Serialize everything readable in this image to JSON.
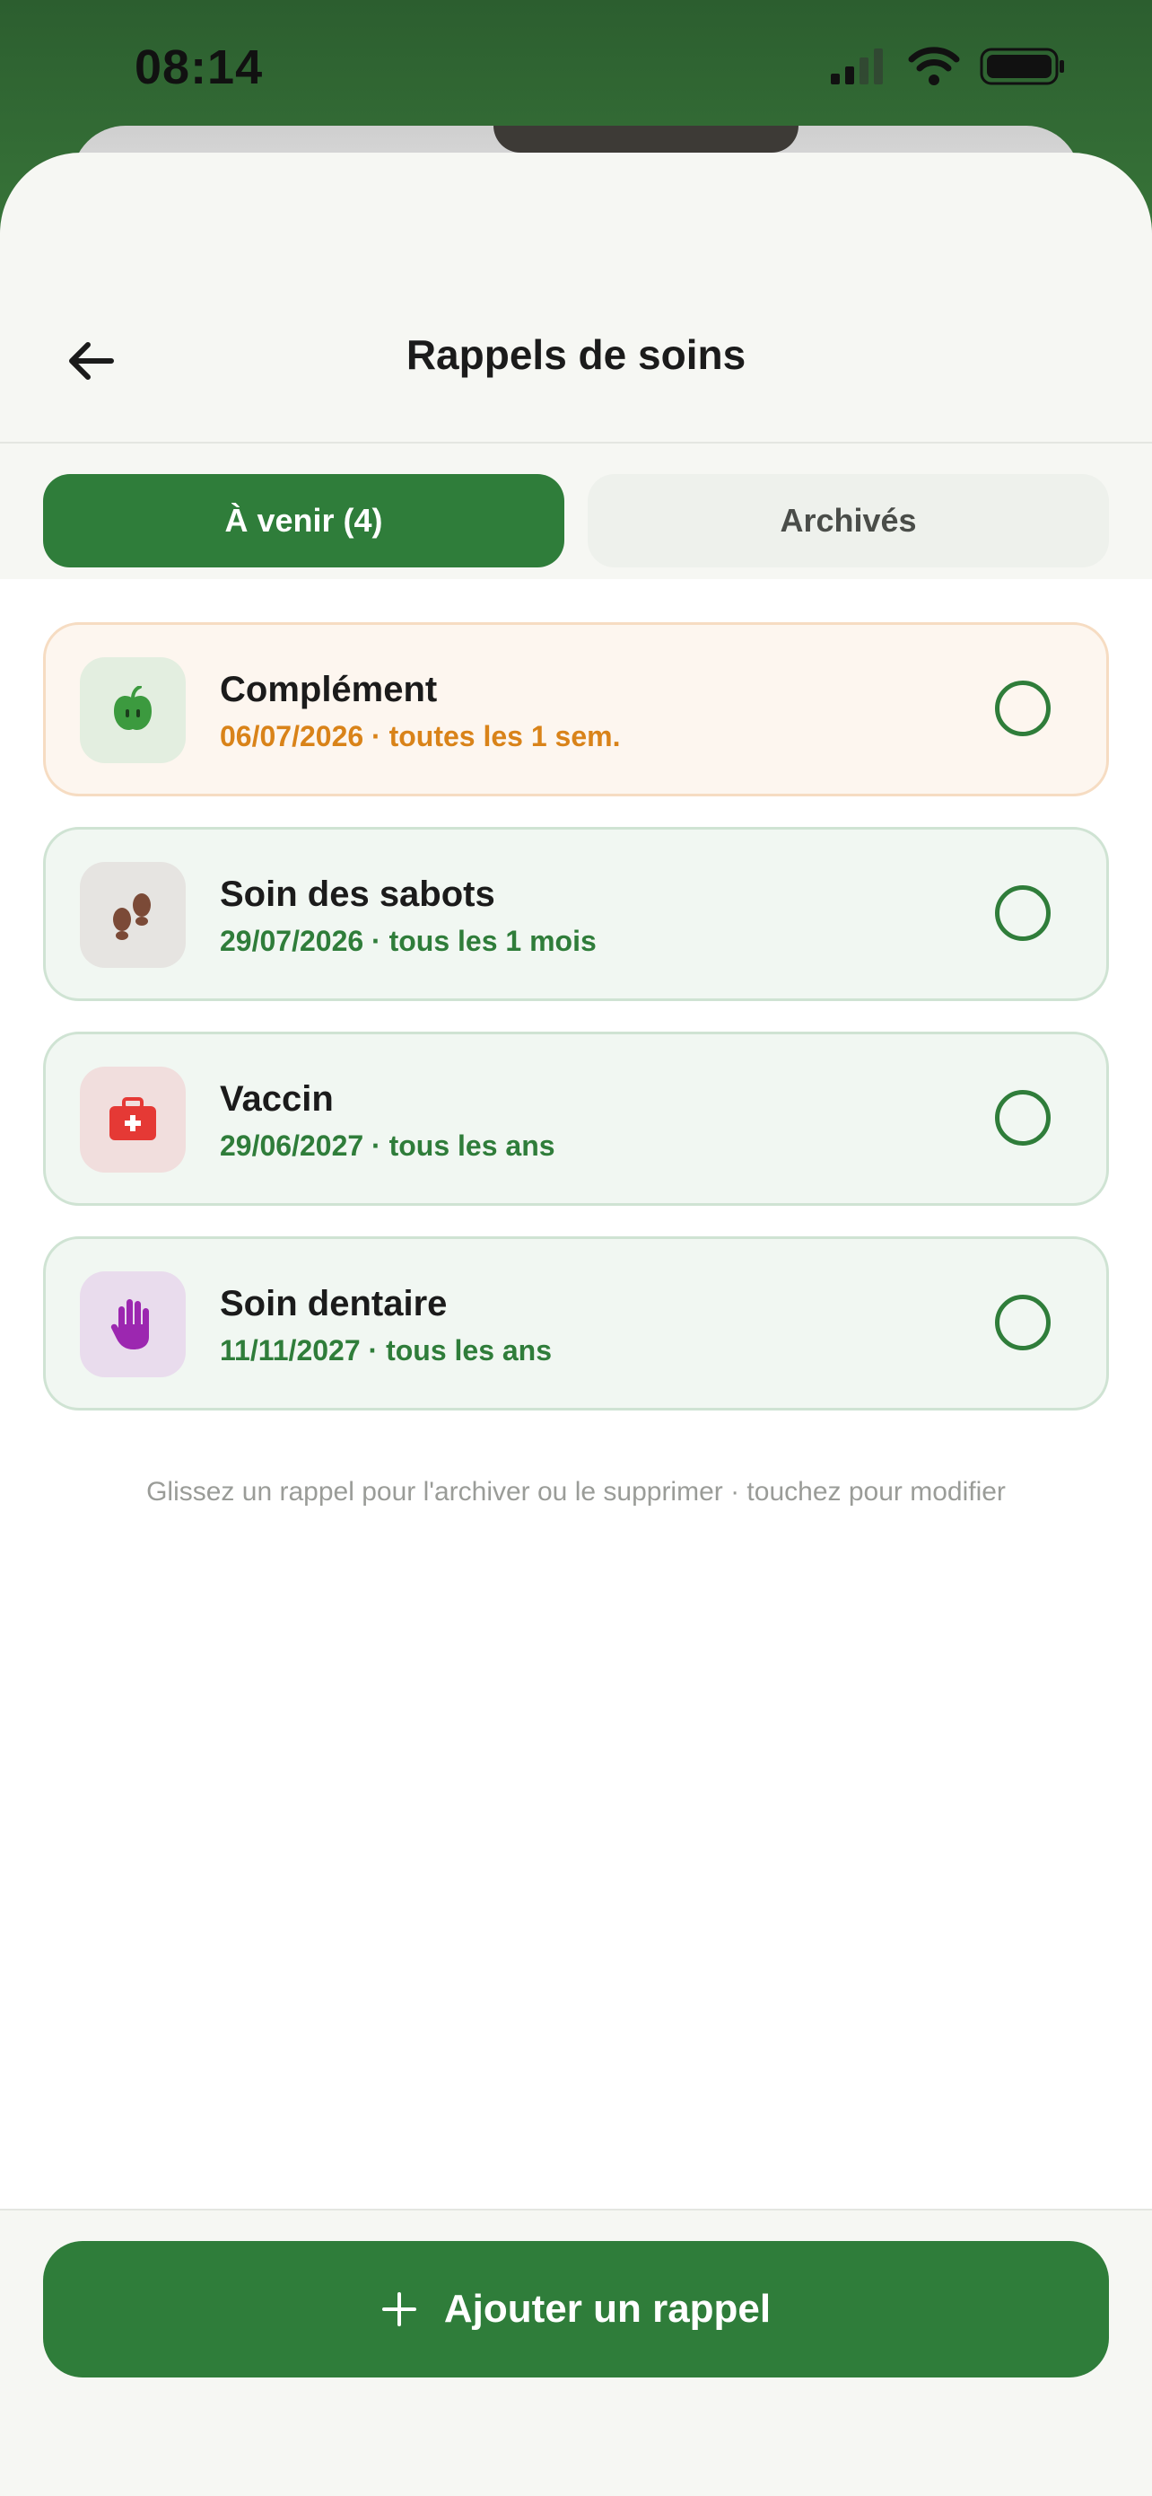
{
  "status": {
    "time": "08:14"
  },
  "header": {
    "title": "Rappels de soins",
    "back_icon": "arrow-left-icon"
  },
  "tabs": [
    {
      "label": "À venir (4)",
      "active": true
    },
    {
      "label": "Archivés",
      "active": false
    }
  ],
  "reminders": [
    {
      "title": "Complément",
      "subtitle": "06/07/2026 · toutes les 1 sem.",
      "icon": "apple-icon",
      "icon_bg": "#e3eee0",
      "icon_color": "#3c9a3f",
      "state": "warning"
    },
    {
      "title": "Soin des sabots",
      "subtitle": "29/07/2026 · tous les 1 mois",
      "icon": "hoofprints-icon",
      "icon_bg": "#e6e4e1",
      "icon_color": "#7b4a37",
      "state": "normal"
    },
    {
      "title": "Vaccin",
      "subtitle": "29/06/2027 · tous les ans",
      "icon": "medical-kit-icon",
      "icon_bg": "#f1dedd",
      "icon_color": "#e53935",
      "state": "normal"
    },
    {
      "title": "Soin dentaire",
      "subtitle": "11/11/2027 · tous les ans",
      "icon": "hand-icon",
      "icon_bg": "#e9dced",
      "icon_color": "#9c27b0",
      "state": "normal"
    }
  ],
  "hint": "Glissez un rappel pour l'archiver ou le supprimer · touchez pour modifier",
  "footer": {
    "add_label": "Ajouter un rappel",
    "add_icon": "plus-icon"
  },
  "colors": {
    "primary": "#2f7d3a",
    "warning": "#d98319"
  }
}
